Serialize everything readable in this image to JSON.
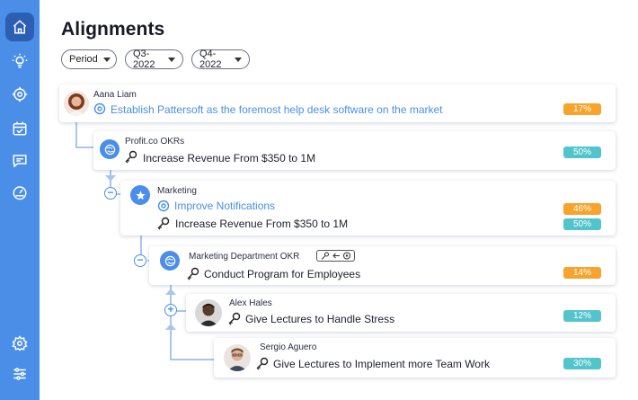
{
  "page": {
    "title": "Alignments"
  },
  "filters": [
    {
      "label": "Period"
    },
    {
      "label": "Q3-2022"
    },
    {
      "label": "Q4-2022"
    }
  ],
  "sidebar": {
    "items": [
      {
        "icon": "home-icon",
        "active": true
      },
      {
        "icon": "lightbulb-icon"
      },
      {
        "icon": "target-icon"
      },
      {
        "icon": "calendar-check-icon"
      },
      {
        "icon": "chat-icon"
      },
      {
        "icon": "gauge-icon"
      },
      {
        "icon": "gear-icon"
      },
      {
        "icon": "sliders-icon"
      }
    ]
  },
  "cards": [
    {
      "owner": "Aana Liam",
      "objective": "Establish Pattersoft as the foremost help desk software on the market",
      "progress": "17%"
    },
    {
      "owner": "Profit.co OKRs",
      "key_result": "Increase Revenue From $350 to 1M",
      "progress": "50%"
    },
    {
      "owner": "Marketing",
      "objective": "Improve Notifications",
      "objective_progress": "46%",
      "key_result": "Increase Revenue From $350 to 1M",
      "key_result_progress": "50%"
    },
    {
      "owner": "Marketing Department OKR",
      "key_result": "Conduct Program for Employees",
      "progress": "14%"
    },
    {
      "owner": "Alex Hales",
      "key_result": "Give Lectures to Handle Stress",
      "progress": "12%"
    },
    {
      "owner": "Sergio Aguero",
      "key_result": "Give Lectures to Implement more Team Work",
      "progress": "30%"
    }
  ],
  "colors": {
    "accent": "#4a8ee8",
    "sidebar": "#4a8ee8",
    "orange": "#f7a32c",
    "teal": "#52c5cc",
    "connector": "#a9c6ef"
  }
}
